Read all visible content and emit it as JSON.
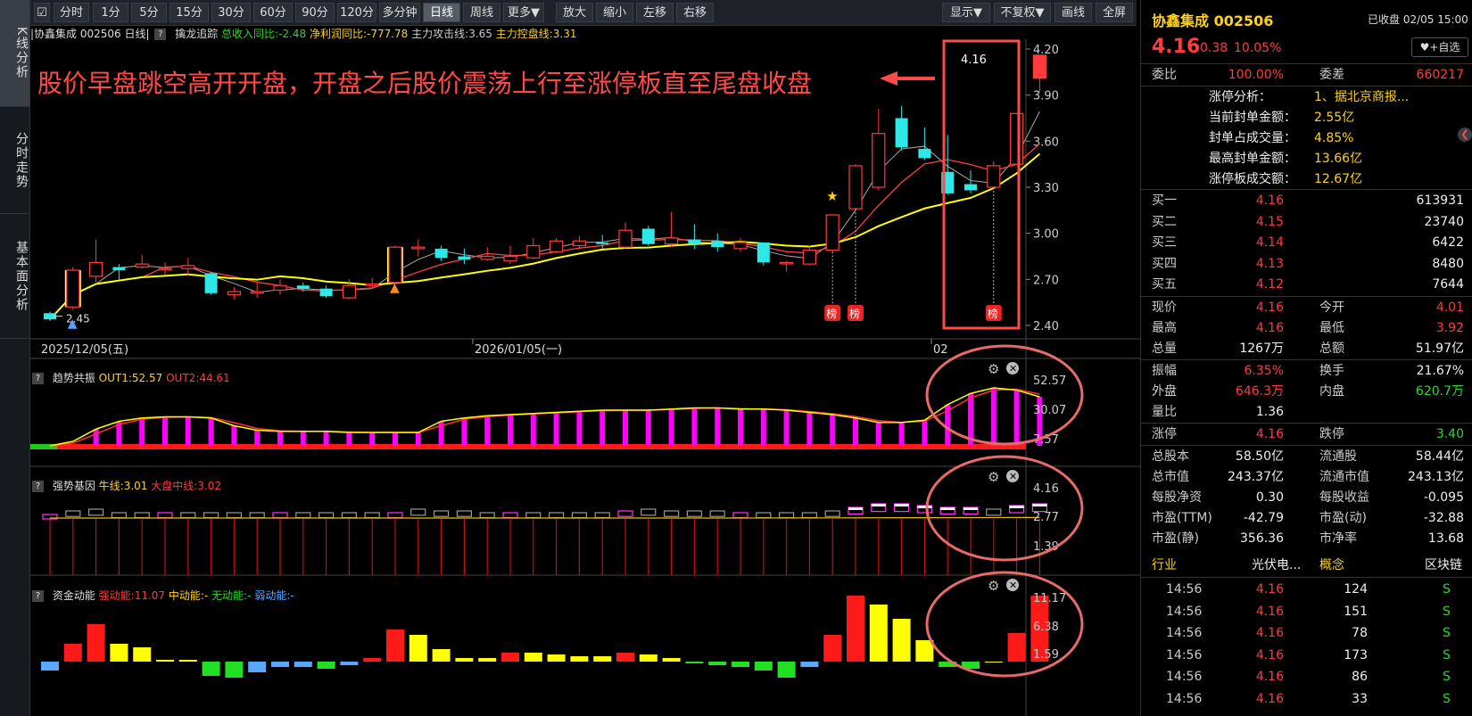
{
  "colors": {
    "up": "#ff3b3b",
    "down": "#2ee8e8",
    "ma1": "#ff4040",
    "ma2": "#ffff00",
    "hl_box": "#ff4a4a",
    "hl_circle": "#e86a6a"
  },
  "left_tabs": [
    "K线分析",
    "分时走势",
    "基本面分析"
  ],
  "toolbar": {
    "periods": [
      "分时",
      "1分",
      "5分",
      "15分",
      "30分",
      "60分",
      "90分",
      "120分",
      "多分钟",
      "日线",
      "周线",
      "更多▼"
    ],
    "tools": [
      "放大",
      "缩小",
      "左移",
      "右移"
    ],
    "right": [
      "显示▼",
      "不复权▼",
      "画线",
      "全屏"
    ]
  },
  "kline_info": {
    "title": "|协鑫集成 002506 日线|",
    "q": "?",
    "indicator": "擒龙追踪",
    "rev": "总收入同比:-2.48",
    "profit": "净利润同比:-777.78",
    "attack": "主力攻击线:3.65",
    "control": "主力控盘线:3.31"
  },
  "annotation": "股价早盘跳空高开开盘，开盘之后股价震荡上行至涨停板直至尾盘收盘",
  "last_price_label": "4.16",
  "low_label": "2.45",
  "bang_label": "榜",
  "y_axis": [
    "4.20",
    "3.90",
    "3.60",
    "3.30",
    "3.00",
    "2.70",
    "2.40"
  ],
  "x_axis": [
    "2025/12/05(五)",
    "2026/01/05(一)",
    "02"
  ],
  "panel2": {
    "q": "?",
    "name": "趋势共振",
    "out1": "OUT1:52.57",
    "out2": "OUT2:44.61",
    "axis": [
      "52.57",
      "30.07",
      "7.57"
    ]
  },
  "panel3": {
    "q": "?",
    "name": "强势基因",
    "bull": "牛线:3.01",
    "mid": "大盘中线:3.02",
    "axis": [
      "4.16",
      "2.77",
      "1.39"
    ]
  },
  "panel4": {
    "q": "?",
    "name": "资金动能",
    "strong": "强动能:11.07",
    "medium": "中动能:-",
    "none": "无动能:-",
    "weak": "弱动能:-",
    "axis": [
      "11.17",
      "6.38",
      "1.59"
    ]
  },
  "chart_data": {
    "type": "candlestick",
    "x_axis_labels": [
      "2025/12/05(五)",
      "2026/01/05(一)",
      "02"
    ],
    "ylim": [
      2.4,
      4.2
    ],
    "candles": [
      [
        2.48,
        2.44,
        2.49,
        2.43
      ],
      [
        2.52,
        2.76,
        2.78,
        2.5
      ],
      [
        2.72,
        2.81,
        2.96,
        2.68
      ],
      [
        2.78,
        2.76,
        2.8,
        2.7
      ],
      [
        2.78,
        2.8,
        2.86,
        2.77
      ],
      [
        2.77,
        2.77,
        2.81,
        2.73
      ],
      [
        2.77,
        2.79,
        2.84,
        2.73
      ],
      [
        2.74,
        2.61,
        2.75,
        2.6
      ],
      [
        2.6,
        2.62,
        2.65,
        2.57
      ],
      [
        2.61,
        2.62,
        2.68,
        2.58
      ],
      [
        2.63,
        2.66,
        2.7,
        2.6
      ],
      [
        2.66,
        2.64,
        2.68,
        2.62
      ],
      [
        2.64,
        2.59,
        2.66,
        2.58
      ],
      [
        2.58,
        2.66,
        2.7,
        2.57
      ],
      [
        2.66,
        2.67,
        2.71,
        2.64
      ],
      [
        2.68,
        2.91,
        2.92,
        2.67
      ],
      [
        2.9,
        2.91,
        2.96,
        2.85
      ],
      [
        2.9,
        2.84,
        2.92,
        2.82
      ],
      [
        2.85,
        2.83,
        2.9,
        2.8
      ],
      [
        2.83,
        2.85,
        2.91,
        2.82
      ],
      [
        2.82,
        2.85,
        2.92,
        2.8
      ],
      [
        2.84,
        2.92,
        2.97,
        2.83
      ],
      [
        2.88,
        2.95,
        2.97,
        2.87
      ],
      [
        2.92,
        2.95,
        2.98,
        2.9
      ],
      [
        2.94,
        2.93,
        2.99,
        2.9
      ],
      [
        2.91,
        3.02,
        3.07,
        2.9
      ],
      [
        3.03,
        2.93,
        3.05,
        2.92
      ],
      [
        2.93,
        2.97,
        3.14,
        2.91
      ],
      [
        2.96,
        2.93,
        3.06,
        2.9
      ],
      [
        2.95,
        2.91,
        3.0,
        2.88
      ],
      [
        2.9,
        2.94,
        2.97,
        2.88
      ],
      [
        2.94,
        2.81,
        2.94,
        2.79
      ],
      [
        2.81,
        2.81,
        2.82,
        2.75
      ],
      [
        2.8,
        2.89,
        2.92,
        2.79
      ],
      [
        2.89,
        3.12,
        3.12,
        2.88
      ],
      [
        3.16,
        3.44,
        3.45,
        3.16
      ],
      [
        3.3,
        3.65,
        3.81,
        3.28
      ],
      [
        3.75,
        3.56,
        3.83,
        3.54
      ],
      [
        3.55,
        3.49,
        3.69,
        3.48
      ],
      [
        3.4,
        3.26,
        3.64,
        3.25
      ],
      [
        3.32,
        3.28,
        3.41,
        3.26
      ],
      [
        3.3,
        3.44,
        3.47,
        3.3
      ],
      [
        3.45,
        3.78,
        3.78,
        3.45
      ],
      [
        4.01,
        4.16,
        4.16,
        3.92
      ]
    ],
    "ma_series": [
      {
        "name": "主力攻击线",
        "last": 3.65
      },
      {
        "name": "主力控盘线",
        "last": 3.31
      }
    ],
    "quote": {
      "last": 4.16,
      "change": 0.38,
      "pct": "10.05%"
    }
  },
  "right_panel": {
    "name": "协鑫集成 002506",
    "status": "已收盘 02/05 15:00",
    "price": "4.16",
    "change": "0.38",
    "pct": "10.05%",
    "watch": "+自选",
    "weibi_label": "委比",
    "weibi": "100.00%",
    "weicha_label": "委差",
    "weicha": "660217",
    "limit_info": [
      {
        "k": "涨停分析：",
        "v": "1、据北京商报..."
      },
      {
        "k": "当前封单金额：",
        "v": "2.55亿"
      },
      {
        "k": "封单占成交量：",
        "v": "4.85%"
      },
      {
        "k": "最高封单金额：",
        "v": "13.66亿"
      },
      {
        "k": "涨停板成交额：",
        "v": "12.67亿"
      }
    ],
    "bids": [
      {
        "k": "买一",
        "p": "4.16",
        "v": "613931"
      },
      {
        "k": "买二",
        "p": "4.15",
        "v": "23740"
      },
      {
        "k": "买三",
        "p": "4.14",
        "v": "6422"
      },
      {
        "k": "买四",
        "p": "4.13",
        "v": "8480"
      },
      {
        "k": "买五",
        "p": "4.12",
        "v": "7644"
      }
    ],
    "stats": [
      {
        "k1": "现价",
        "v1": "4.16",
        "c1": "red",
        "k2": "今开",
        "v2": "4.01",
        "c2": "red"
      },
      {
        "k1": "最高",
        "v1": "4.16",
        "c1": "red",
        "k2": "最低",
        "v2": "3.92",
        "c2": "red"
      },
      {
        "k1": "总量",
        "v1": "1267万",
        "c1": "wht",
        "k2": "总额",
        "v2": "51.97亿",
        "c2": "wht"
      },
      {
        "k1": "振幅",
        "v1": "6.35%",
        "c1": "red",
        "k2": "换手",
        "v2": "21.67%",
        "c2": "wht"
      },
      {
        "k1": "外盘",
        "v1": "646.3万",
        "c1": "red",
        "k2": "内盘",
        "v2": "620.7万",
        "c2": "grn"
      },
      {
        "k1": "量比",
        "v1": "1.36",
        "c1": "wht",
        "k2": "",
        "v2": "",
        "c2": "wht"
      },
      {
        "k1": "涨停",
        "v1": "4.16",
        "c1": "red",
        "k2": "跌停",
        "v2": "3.40",
        "c2": "grn"
      },
      {
        "k1": "总股本",
        "v1": "58.50亿",
        "c1": "wht",
        "k2": "流通股",
        "v2": "58.44亿",
        "c2": "wht"
      },
      {
        "k1": "总市值",
        "v1": "243.37亿",
        "c1": "wht",
        "k2": "流通市值",
        "v2": "243.13亿",
        "c2": "wht"
      },
      {
        "k1": "每股净资",
        "v1": "0.30",
        "c1": "wht",
        "k2": "每股收益",
        "v2": "-0.095",
        "c2": "wht"
      },
      {
        "k1": "市盈(TTM)",
        "v1": "-42.79",
        "c1": "wht",
        "k2": "市盈(动)",
        "v2": "-32.88",
        "c2": "wht"
      },
      {
        "k1": "市盈(静)",
        "v1": "356.36",
        "c1": "wht",
        "k2": "市净率",
        "v2": "13.68",
        "c2": "wht"
      }
    ],
    "industry": {
      "k1": "行业",
      "v1": "光伏电...",
      "k2": "概念",
      "v2": "区块链"
    },
    "ticks": [
      {
        "t": "14:56",
        "p": "4.16",
        "v": "124",
        "s": "S"
      },
      {
        "t": "14:56",
        "p": "4.16",
        "v": "151",
        "s": "S"
      },
      {
        "t": "14:56",
        "p": "4.16",
        "v": "78",
        "s": "S"
      },
      {
        "t": "14:56",
        "p": "4.16",
        "v": "173",
        "s": "S"
      },
      {
        "t": "14:56",
        "p": "4.16",
        "v": "86",
        "s": "S"
      },
      {
        "t": "14:56",
        "p": "4.16",
        "v": "33",
        "s": "S"
      }
    ]
  }
}
